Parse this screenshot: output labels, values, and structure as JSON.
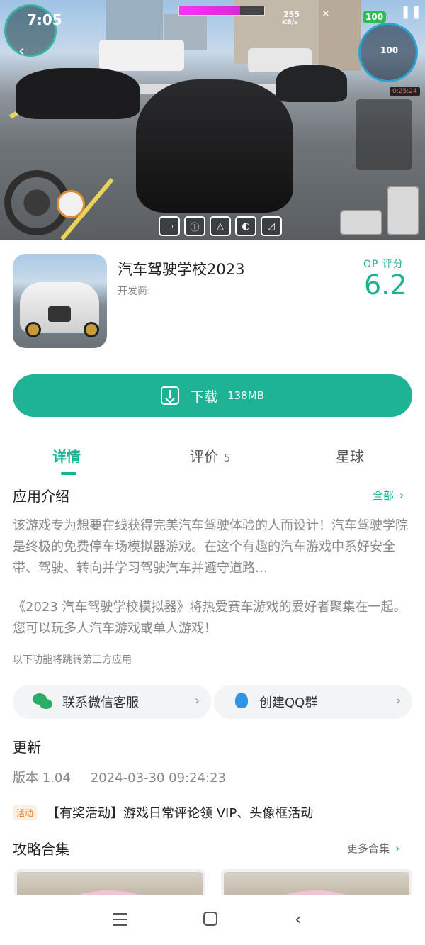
{
  "hud": {
    "time": "7:05",
    "net_speed": "255",
    "net_unit": "KB/s",
    "battery": "100",
    "speed": "100",
    "timer": "0:25:24",
    "fuel_level": 0.72
  },
  "app": {
    "title": "汽车驾驶学校2023",
    "developer": "开发商:",
    "score_label": "OP 评分",
    "score": "6.2"
  },
  "download": {
    "label": "下载",
    "size": "138MB"
  },
  "tabs": [
    {
      "label": "详情",
      "count": ""
    },
    {
      "label": "评价",
      "count": "5"
    },
    {
      "label": "星球",
      "count": ""
    }
  ],
  "intro": {
    "title": "应用介绍",
    "more": "全部",
    "para1": "该游戏专为想要在线获得完美汽车驾驶体验的人而设计！汽车驾驶学院是终极的免费停车场模拟器游戏。在这个有趣的汽车游戏中系好安全带、驾驶、转向并学习驾驶汽车并遵守道路…",
    "para2": "《2023 汽车驾驶学校模拟器》将热爱赛车游戏的爱好者聚集在一起。您可以玩多人汽车游戏或单人游戏！",
    "note": "以下功能将跳转第三方应用"
  },
  "contact": {
    "wechat": "联系微信客服",
    "qq": "创建QQ群"
  },
  "update": {
    "title": "更新",
    "version": "版本 1.04",
    "date": "2024-03-30 09:24:23"
  },
  "activity": {
    "badge": "活动",
    "text": "【有奖活动】游戏日常评论领 VIP、头像框活动"
  },
  "guides": {
    "title": "攻略合集",
    "more": "更多合集"
  }
}
